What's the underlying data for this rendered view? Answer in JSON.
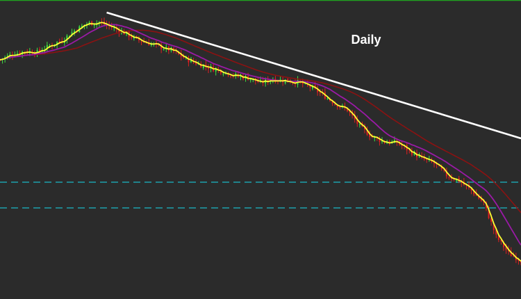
{
  "chart_data": {
    "type": "candlestick",
    "title": "Daily",
    "xlabel": "",
    "ylabel": "",
    "grid": false,
    "ylim": [
      0,
      430
    ],
    "xlim": [
      0,
      210
    ],
    "colors": {
      "background": "#2b2b2b",
      "border_top": "#1fa31f",
      "bar_up": "#3fe03f",
      "bar_down": "#e02020",
      "ma_fast": "#ffff33",
      "ma_mid": "#9a1aa6",
      "ma_slow": "#8b1212",
      "trendline": "#ffffff",
      "levels": "#19b8c6",
      "title": "#ffffff"
    },
    "anchors": [
      [
        0,
        344
      ],
      [
        5,
        352
      ],
      [
        10,
        356
      ],
      [
        15,
        355
      ],
      [
        20,
        364
      ],
      [
        25,
        372
      ],
      [
        30,
        386
      ],
      [
        35,
        396
      ],
      [
        40,
        398
      ],
      [
        45,
        391
      ],
      [
        50,
        383
      ],
      [
        55,
        373
      ],
      [
        60,
        368
      ],
      [
        65,
        362
      ],
      [
        70,
        356
      ],
      [
        75,
        345
      ],
      [
        80,
        338
      ],
      [
        85,
        332
      ],
      [
        90,
        327
      ],
      [
        95,
        321
      ],
      [
        100,
        318
      ],
      [
        105,
        311
      ],
      [
        110,
        316
      ],
      [
        115,
        314
      ],
      [
        120,
        312
      ],
      [
        125,
        305
      ],
      [
        130,
        294
      ],
      [
        135,
        281
      ],
      [
        140,
        272
      ],
      [
        145,
        248
      ],
      [
        150,
        233
      ],
      [
        155,
        226
      ],
      [
        160,
        225
      ],
      [
        165,
        213
      ],
      [
        170,
        202
      ],
      [
        175,
        195
      ],
      [
        180,
        178
      ],
      [
        185,
        170
      ],
      [
        190,
        156
      ],
      [
        195,
        138
      ],
      [
        200,
        90
      ],
      [
        205,
        66
      ],
      [
        210,
        55
      ]
    ],
    "trendline": {
      "x": [
        43,
        210
      ],
      "y": [
        412,
        231
      ]
    },
    "levels": [
      168,
      131
    ],
    "ma_fast_period": 3,
    "ma_mid_period": 14,
    "ma_slow_period": 32
  }
}
